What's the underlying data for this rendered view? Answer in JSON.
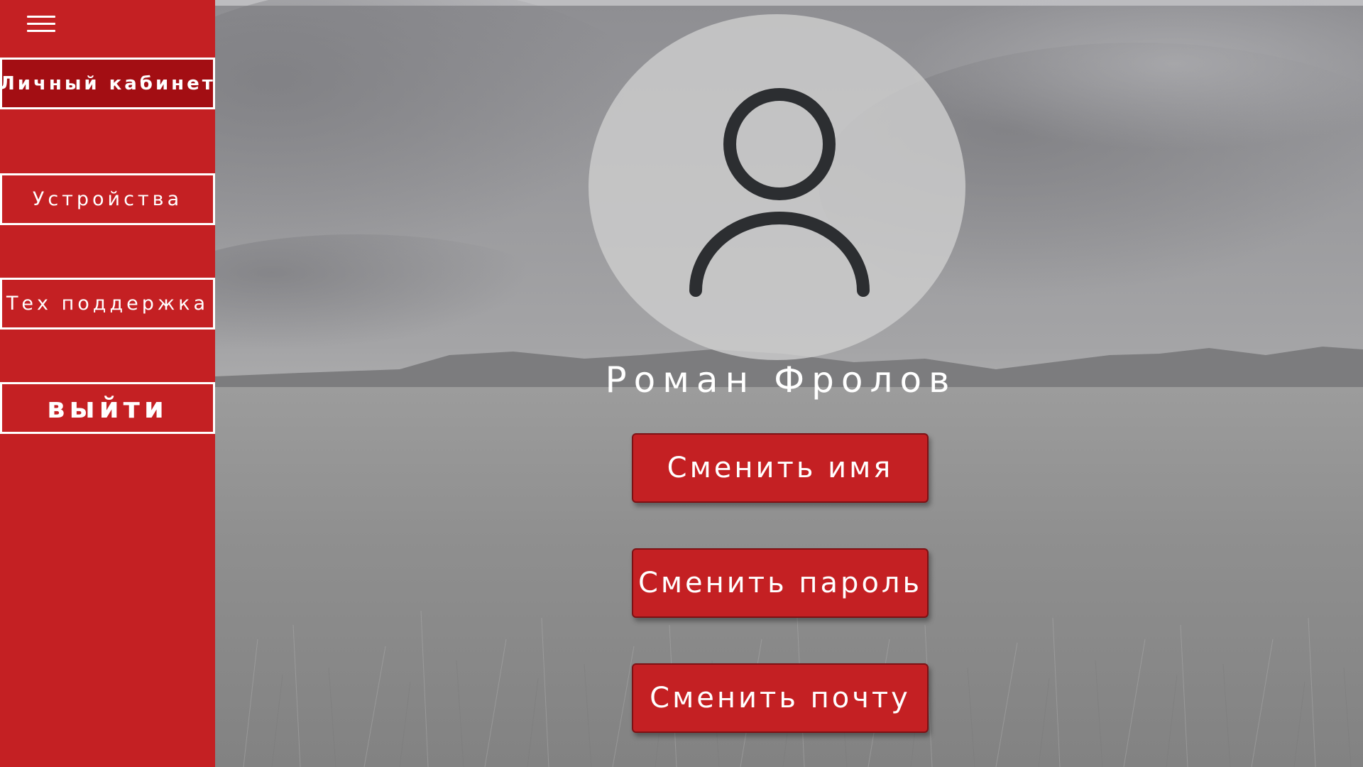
{
  "sidebar": {
    "menu_icon": "hamburger-menu-icon",
    "items": [
      {
        "label": "Личный кабинет",
        "active": true
      },
      {
        "label": "Устройства",
        "active": false
      },
      {
        "label": "Тех поддержка",
        "active": false
      }
    ],
    "logout_label": "выйти"
  },
  "profile": {
    "avatar_icon": "user-icon",
    "name": "Роман Фролов"
  },
  "actions": {
    "change_name": "Сменить имя",
    "change_password": "Сменить пароль",
    "change_email": "Сменить почту"
  },
  "colors": {
    "accent_red": "#c42023",
    "active_red": "#a30e13",
    "text_white": "#ffffff"
  }
}
